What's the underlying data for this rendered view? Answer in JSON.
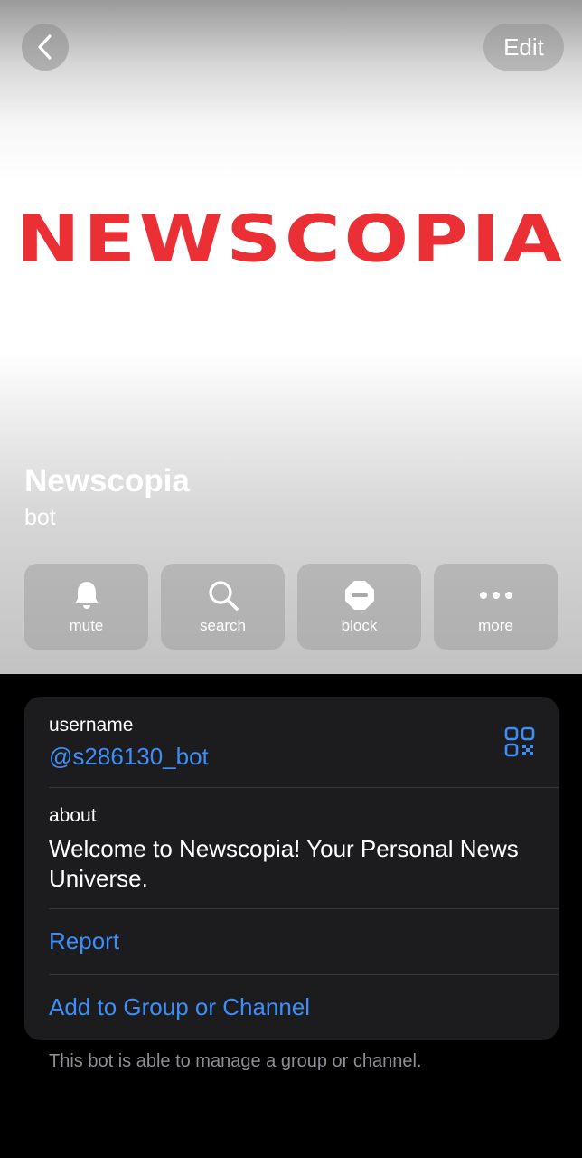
{
  "header": {
    "edit_label": "Edit",
    "logo_text": "NEWSCOPIA",
    "name": "Newscopia",
    "subtitle": "bot",
    "actions": [
      {
        "label": "mute",
        "icon": "bell-icon"
      },
      {
        "label": "search",
        "icon": "search-icon"
      },
      {
        "label": "block",
        "icon": "block-icon"
      },
      {
        "label": "more",
        "icon": "more-icon"
      }
    ]
  },
  "info": {
    "username_label": "username",
    "username_value": "@s286130_bot",
    "about_label": "about",
    "about_value": "Welcome to Newscopia! Your Personal News Universe.",
    "report_label": "Report",
    "add_label": "Add to Group or Channel"
  },
  "footer_note": "This bot is able to manage a group or channel.",
  "colors": {
    "accent": "#3e8ef7",
    "logo": "#ea2f35",
    "card": "#1c1c1e"
  }
}
